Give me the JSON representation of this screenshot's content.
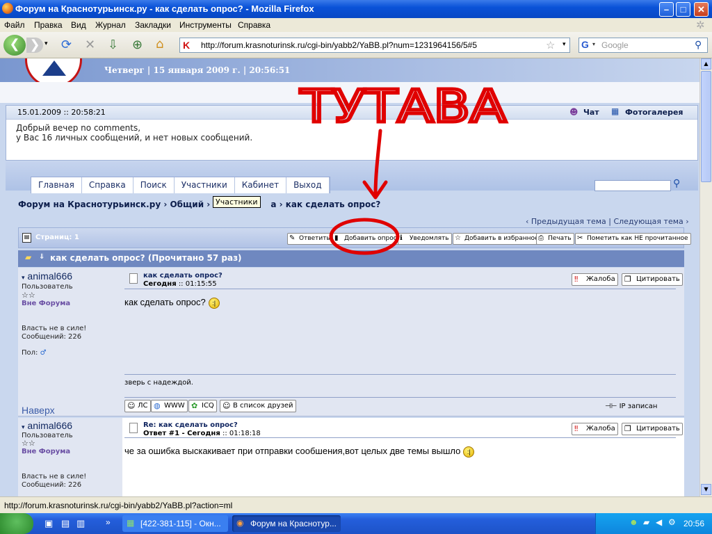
{
  "window": {
    "title": "Форум на Краснотурьинск.ру - как сделать опрос? - Mozilla Firefox"
  },
  "menu": [
    "Файл",
    "Правка",
    "Вид",
    "Журнал",
    "Закладки",
    "Инструменты",
    "Справка"
  ],
  "nav": {
    "url": "http://forum.krasnoturinsk.ru/cgi-bin/yabb2/YaBB.pl?num=1231964156/5#5",
    "search_placeholder": "Google"
  },
  "header": {
    "dateline": "Четверг | 15 января 2009 г. | 20:56:51"
  },
  "info": {
    "datetime": "15.01.2009 :: 20:58:21",
    "chat": "Чат",
    "gallery": "Фотогалерея",
    "greeting": "Добрый вечер no comments,",
    "messages": "у Вас 16 личных сообщений, и нет новых сообщений."
  },
  "tabs": [
    "Главная",
    "Справка",
    "Поиск",
    "Участники",
    "Кабинет",
    "Выход"
  ],
  "breadcrumb": {
    "a": "Форум на Краснотурьинск.ру",
    "b": "Общий",
    "c_start": "Ра",
    "c_end": "а",
    "d": "как сделать опрос?"
  },
  "tooltip": "Участники",
  "prevnext": {
    "prev": "‹ Предыдущая тема",
    "next": "Следующая тема ›"
  },
  "pagebar": {
    "pages": "Страниц: 1",
    "buttons": [
      "Ответить",
      "Добавить опрос",
      "Уведомлять",
      "Добавить в избранное",
      "Печать",
      "Пометить как НЕ прочитанное"
    ]
  },
  "topic": {
    "title": "как сделать опрос? (Прочитано 57 раз)"
  },
  "posts": [
    {
      "user": "animal666",
      "rank": "Пользователь",
      "status": "Вне Форума",
      "text1": "Власть не в силе!",
      "count": "Сообщений: 226",
      "gender": "Пол:",
      "title": "как сделать опрос?",
      "date_today": "Сегодня",
      "date_time": ":: 01:15:55",
      "message": "как сделать опрос?",
      "signature": "зверь с надеждой.",
      "top_link": "Наверх",
      "buttons": [
        "ЛС",
        "WWW",
        "ICQ",
        "В список друзей"
      ],
      "ip": "IP записан",
      "report": "Жалоба",
      "quote": "Цитировать"
    },
    {
      "user": "animal666",
      "rank": "Пользователь",
      "status": "Вне Форума",
      "text1": "Власть не в силе!",
      "count": "Сообщений: 226",
      "title": "Re: как сделать опрос?",
      "reply_info": "Ответ #1 - Сегодня",
      "date_time": ":: 01:18:18",
      "message": "че за ошибка выскакивает  при отправки сообшения,вот целых две темы вышло",
      "report": "Жалоба",
      "quote": "Цитировать"
    }
  ],
  "annotation": {
    "text": "ТУТАВА",
    "color": "#e00000"
  },
  "status": {
    "url": "http://forum.krasnoturinsk.ru/cgi-bin/yabb2/YaBB.pl?action=ml"
  },
  "taskbar": {
    "tasks": [
      "[422-381-115] - Окн...",
      "Форум на Краснотур..."
    ],
    "lang": "EN",
    "clock": "20:56"
  }
}
